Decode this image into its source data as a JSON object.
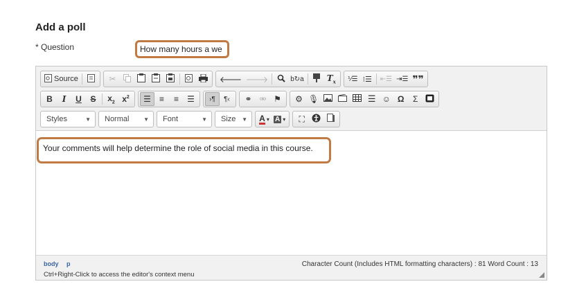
{
  "form": {
    "heading": "Add a poll",
    "question_label": "* Question",
    "question_value": "How many hours a we"
  },
  "toolbar": {
    "row1": {
      "source_label": "Source"
    },
    "row2": {
      "bold": "B",
      "italic": "I",
      "underline": "U",
      "strike": "S"
    },
    "row3": {
      "styles": "Styles",
      "format": "Normal",
      "font": "Font",
      "size": "Size"
    }
  },
  "editor": {
    "content": "Your comments will help determine the role of social media in this course."
  },
  "status": {
    "path": [
      "body",
      "p"
    ],
    "hint": "Ctrl+Right-Click to access the editor's context menu",
    "count": "Character Count (Includes HTML formatting characters) : 81 Word Count : 13"
  },
  "colors": {
    "highlight": "#c07a43",
    "toolbar_bg": "#f1f1f1",
    "path_link": "#3a63a6"
  },
  "icons": [
    "source-icon",
    "templates-icon",
    "cut-icon",
    "copy-icon",
    "paste-icon",
    "paste-text-icon",
    "paste-word-icon",
    "preview-icon",
    "print-icon",
    "undo-icon",
    "redo-icon",
    "find-icon",
    "replace-icon",
    "spellcheck-icon",
    "remove-format-icon",
    "numbered-list-icon",
    "bulleted-list-icon",
    "outdent-icon",
    "indent-icon",
    "blockquote-icon",
    "subscript-icon",
    "superscript-icon",
    "align-left-icon",
    "align-center-icon",
    "align-right-icon",
    "justify-icon",
    "ltr-icon",
    "rtl-icon",
    "link-icon",
    "unlink-icon",
    "anchor-icon",
    "settings-icon",
    "microphone-icon",
    "image-icon",
    "media-icon",
    "table-icon",
    "horizontal-rule-icon",
    "smiley-icon",
    "omega-icon",
    "sigma-icon",
    "flash-icon",
    "text-color-icon",
    "background-color-icon",
    "maximize-icon",
    "accessibility-icon",
    "show-blocks-icon",
    "chevron-down-icon",
    "resize-icon"
  ]
}
